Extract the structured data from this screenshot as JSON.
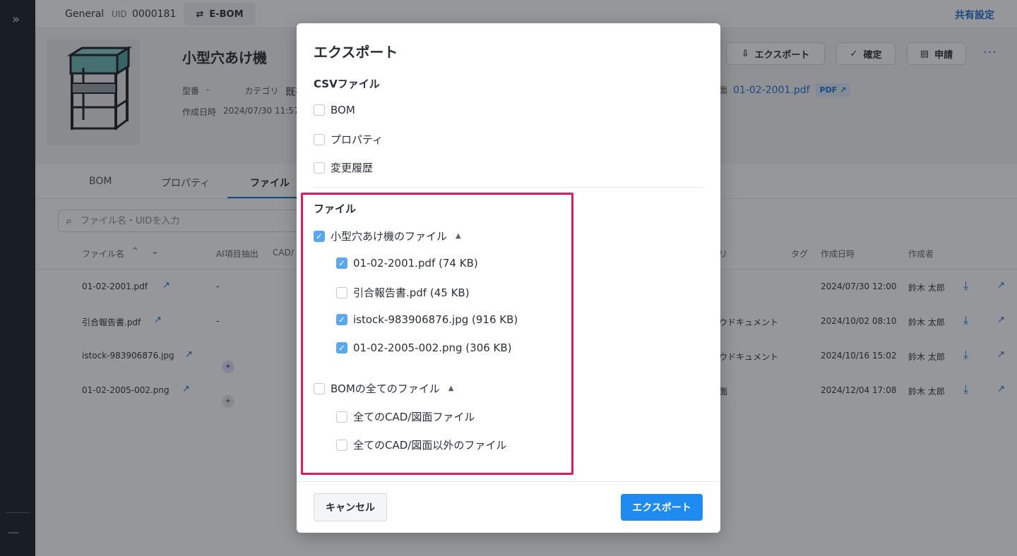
{
  "topbar": {
    "workspace": "General",
    "uid_label": "UID",
    "uid_value": "0000181",
    "ebom_label": "E-BOM",
    "share_label": "共有設定"
  },
  "item": {
    "title": "小型穴あけ機",
    "model_label": "型番",
    "model_value": "-",
    "category_label": "カテゴリ",
    "category_value": "既存",
    "created_label": "作成日時",
    "created_value": "2024/07/30 11:57",
    "drawing_label": "面",
    "drawing_file": "01-02-2001.pdf",
    "pdf_badge": "PDF"
  },
  "header_actions": {
    "export_label": "エクスポート",
    "confirm_label": "確定",
    "apply_label": "申請",
    "more_label": "···"
  },
  "tabs": [
    "BOM",
    "プロパティ",
    "ファイル"
  ],
  "search": {
    "placeholder": "ファイル名・UIDを入力"
  },
  "table": {
    "headers": {
      "filename": "ファイル名",
      "ai": "AI項目抽出",
      "cad": "CAD/",
      "category": "リ",
      "tag": "タグ",
      "created": "作成日時",
      "author": "作成者"
    },
    "rows": [
      {
        "name": "01-02-2001.pdf",
        "ai": "-",
        "category": "",
        "created": "2024/07/30 12:00",
        "author": "鈴木 太郎"
      },
      {
        "name": "引合報告書.pdf",
        "ai": "-",
        "category": "ウドキュメント",
        "created": "2024/10/02 08:10",
        "author": "鈴木 太郎"
      },
      {
        "name": "istock-983906876.jpg",
        "ai": "",
        "category": "ウドキュメント",
        "created": "2024/10/16 15:02",
        "author": "鈴木 太郎"
      },
      {
        "name": "01-02-2005-002.png",
        "ai": "",
        "category": "面",
        "created": "2024/12/04 17:08",
        "author": "鈴木 太郎"
      }
    ]
  },
  "modal": {
    "title": "エクスポート",
    "csv_section": "CSVファイル",
    "csv_options": [
      {
        "label": "BOM",
        "checked": false
      },
      {
        "label": "プロパティ",
        "checked": false
      },
      {
        "label": "変更履歴",
        "checked": false
      }
    ],
    "file_section": "ファイル",
    "item_files_group": {
      "label": "小型穴あけ機のファイル",
      "checked": true
    },
    "item_files": [
      {
        "label": "01-02-2001.pdf  (74 KB)",
        "checked": true
      },
      {
        "label": "引合報告書.pdf  (45 KB)",
        "checked": false
      },
      {
        "label": "istock-983906876.jpg  (916 KB)",
        "checked": true
      },
      {
        "label": "01-02-2005-002.png  (306 KB)",
        "checked": true
      }
    ],
    "bom_files_group": {
      "label": "BOMの全てのファイル",
      "checked": false
    },
    "bom_files": [
      {
        "label": "全てのCAD/図面ファイル",
        "checked": false
      },
      {
        "label": "全てのCAD/図面以外のファイル",
        "checked": false
      }
    ],
    "cancel_label": "キャンセル",
    "export_label": "エクスポート"
  },
  "colors": {
    "accent": "#1f8bf0",
    "checkbox_checked": "#5aa7ee",
    "highlight": "#e0195a",
    "rail": "#1e2228"
  }
}
